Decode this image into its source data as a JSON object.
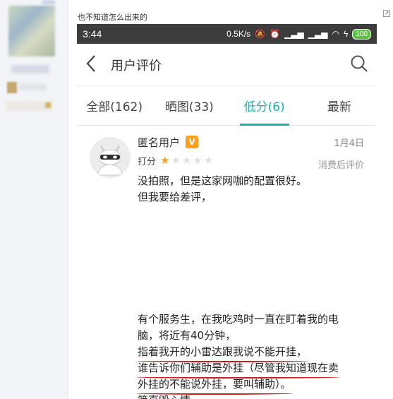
{
  "caption": "也不知道怎么出来的",
  "status_bar": {
    "time": "3:44",
    "speed": "0.5K/s",
    "battery": "100"
  },
  "appbar": {
    "title": "用户评价"
  },
  "tabs": [
    {
      "label": "全部(162)",
      "active": false
    },
    {
      "label": "晒图(33)",
      "active": false
    },
    {
      "label": "低分(6)",
      "active": true
    },
    {
      "label": "最新",
      "active": false
    }
  ],
  "review": {
    "user": "匿名用户",
    "badge": "V",
    "date": "1月4日",
    "rating_label": "打分",
    "rating": 1,
    "rating_max": 5,
    "after": "消费后评价",
    "paragraph1": [
      "没拍照，但是这家网咖的配置很好。",
      "但我要给差评，"
    ],
    "paragraph2": [
      "有个服务生，在我吃鸡时一直在盯着我的电",
      "脑，将近有40分钟，",
      "指着我开的小雷达跟我说不能开挂，",
      "谁告诉你们辅助是外挂（尽管我知道现在卖",
      "外挂的不能说外挂，要叫辅助）。",
      "简直毁心情。"
    ]
  },
  "colors": {
    "accent": "#1ab3a6",
    "star": "#ff9e1b",
    "annotation": "#d21b1b"
  }
}
